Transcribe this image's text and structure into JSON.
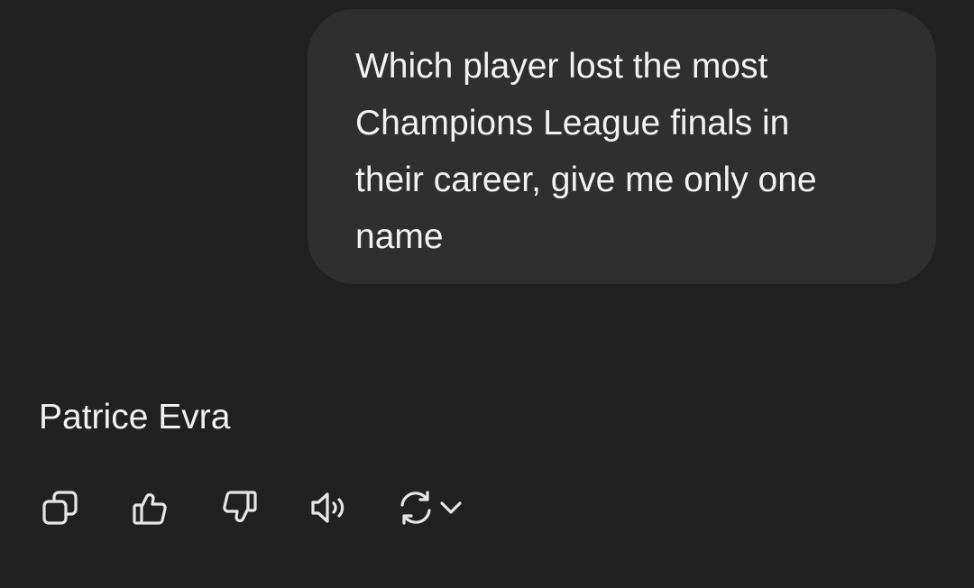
{
  "conversation": {
    "user_message": "Which player lost the most\nChampions League finals in\ntheir career, give me only one\nname",
    "assistant_message": "Patrice Evra"
  },
  "actions": [
    {
      "name": "copy-icon",
      "interactable": true
    },
    {
      "name": "thumbs-up-icon",
      "interactable": true
    },
    {
      "name": "thumbs-down-icon",
      "interactable": true
    },
    {
      "name": "read-aloud-icon",
      "interactable": true
    },
    {
      "name": "regenerate-icon",
      "interactable": true
    },
    {
      "name": "chevron-down-icon",
      "interactable": true
    }
  ],
  "colors": {
    "background": "#212121",
    "user_bubble": "#2f2f2f",
    "text": "#f2f2f2",
    "icon": "#e6e6e6"
  }
}
